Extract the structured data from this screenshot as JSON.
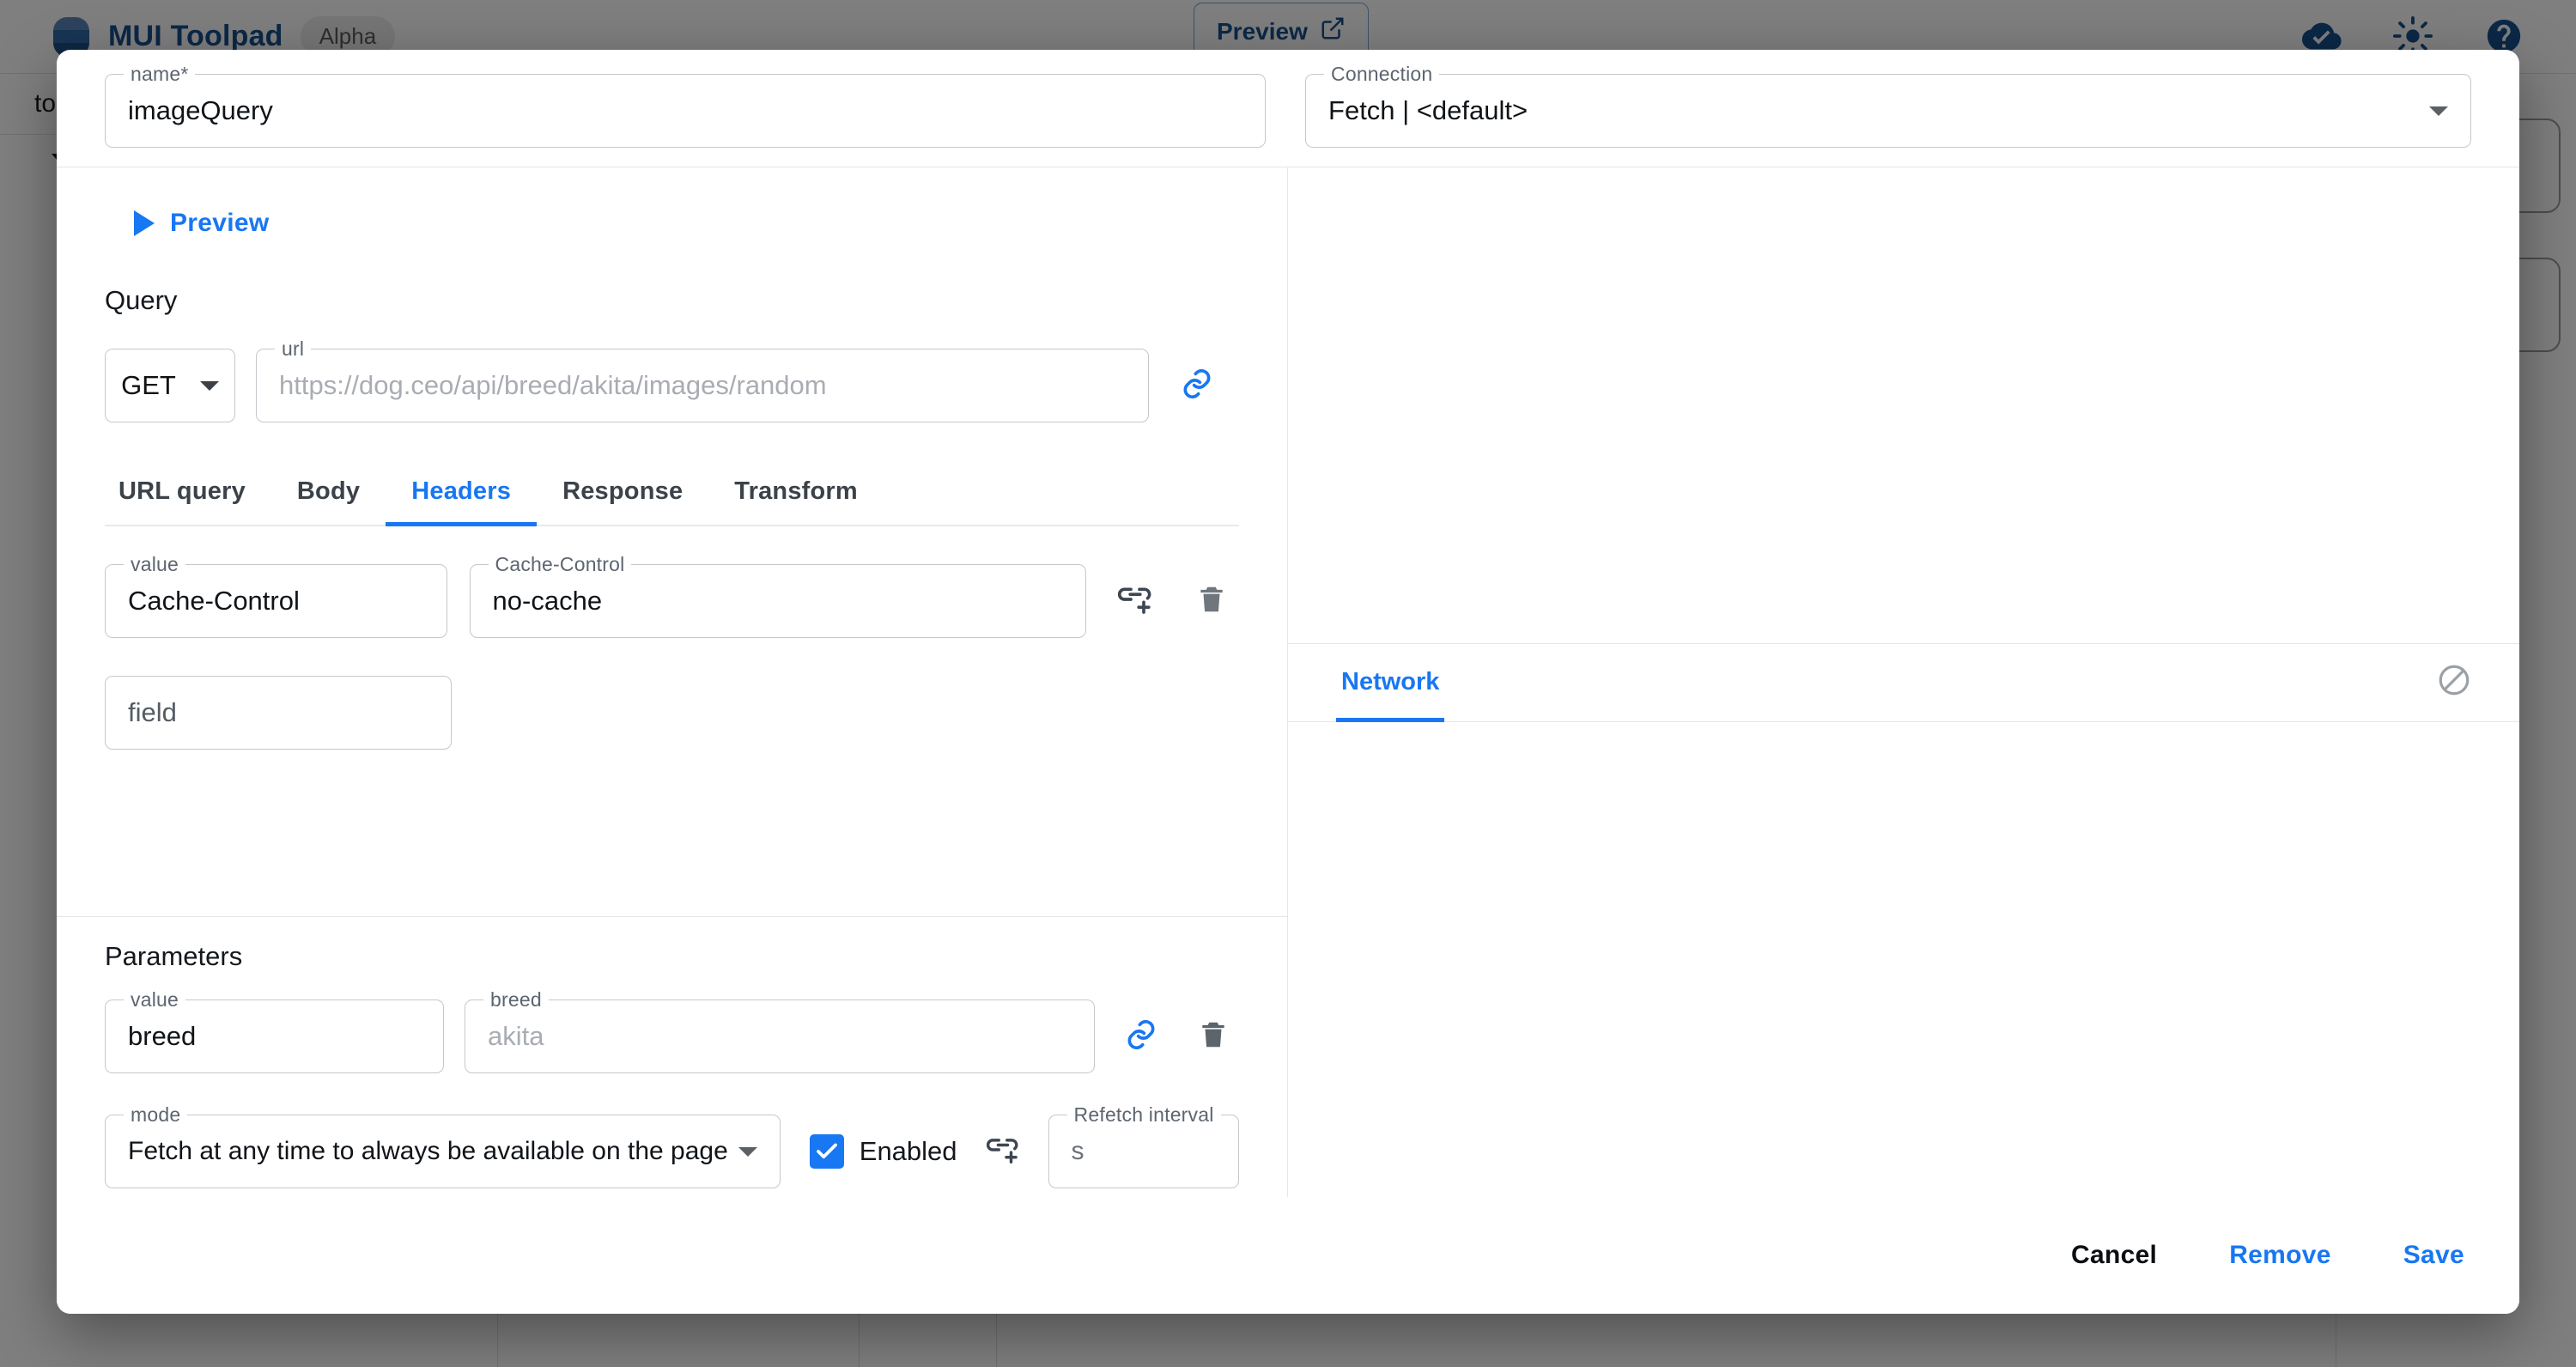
{
  "background": {
    "app_title": "MUI Toolpad",
    "version_chip": "Alpha",
    "preview_button": "Preview",
    "sidebar_label": "to",
    "icons": [
      "cloud-done-icon",
      "brightness-icon",
      "help-icon",
      "open-in-new-icon"
    ]
  },
  "dialog": {
    "name_field": {
      "label": "name*",
      "value": "imageQuery"
    },
    "connection_field": {
      "label": "Connection",
      "value": "Fetch | <default>"
    },
    "preview_toggle": "Preview",
    "query_section": "Query",
    "method": "GET",
    "url_field": {
      "label": "url",
      "placeholder": "https://dog.ceo/api/breed/akita/images/random"
    },
    "tabs": [
      {
        "label": "URL query",
        "active": false
      },
      {
        "label": "Body",
        "active": false
      },
      {
        "label": "Headers",
        "active": true
      },
      {
        "label": "Response",
        "active": false
      },
      {
        "label": "Transform",
        "active": false
      }
    ],
    "headers": {
      "rows": [
        {
          "key_label": "value",
          "key_value": "Cache-Control",
          "val_label": "Cache-Control",
          "val_value": "no-cache"
        }
      ],
      "new_field_placeholder": "field"
    },
    "parameters": {
      "title": "Parameters",
      "rows": [
        {
          "key_label": "value",
          "key_value": "breed",
          "val_label": "breed",
          "val_placeholder": "akita"
        }
      ]
    },
    "mode_field": {
      "label": "mode",
      "value": "Fetch at any time to always be available on the page"
    },
    "enabled_checkbox": {
      "label": "Enabled",
      "checked": true
    },
    "refetch_field": {
      "label": "Refetch interval",
      "value": "s"
    },
    "right_panel": {
      "tab": "Network",
      "clear_icon": "block-icon"
    },
    "footer": {
      "cancel": "Cancel",
      "remove": "Remove",
      "save": "Save"
    }
  },
  "colors": {
    "accent": "#1877f2",
    "brand": "#17518f",
    "text": "#14181c",
    "muted": "#a9adb3",
    "border": "#c4c7cc"
  }
}
